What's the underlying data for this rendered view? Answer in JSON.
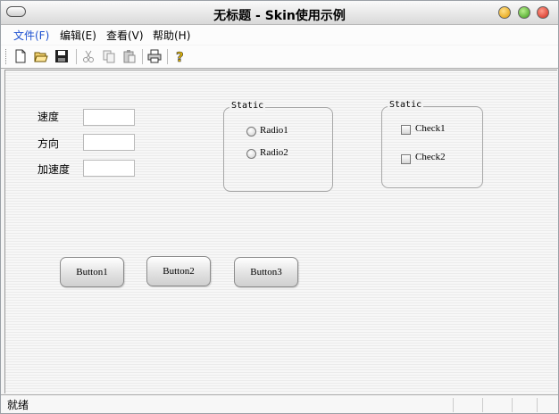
{
  "window": {
    "title": "无标题 - Skin使用示例"
  },
  "menu": {
    "file": "文件(F)",
    "edit": "编辑(E)",
    "view": "查看(V)",
    "help": "帮助(H)"
  },
  "toolbar": {
    "icons": [
      "new-icon",
      "open-icon",
      "save-icon",
      "cut-icon",
      "copy-icon",
      "paste-icon",
      "print-icon",
      "help-icon"
    ]
  },
  "form": {
    "speed_label": "速度",
    "direction_label": "方向",
    "acceleration_label": "加速度",
    "speed_value": "",
    "direction_value": "",
    "acceleration_value": ""
  },
  "radio_group": {
    "title": "Static",
    "radio1": "Radio1",
    "radio2": "Radio2"
  },
  "check_group": {
    "title": "Static",
    "check1": "Check1",
    "check2": "Check2"
  },
  "buttons": {
    "button1": "Button1",
    "button2": "Button2",
    "button3": "Button3"
  },
  "status": {
    "text": "就绪"
  }
}
